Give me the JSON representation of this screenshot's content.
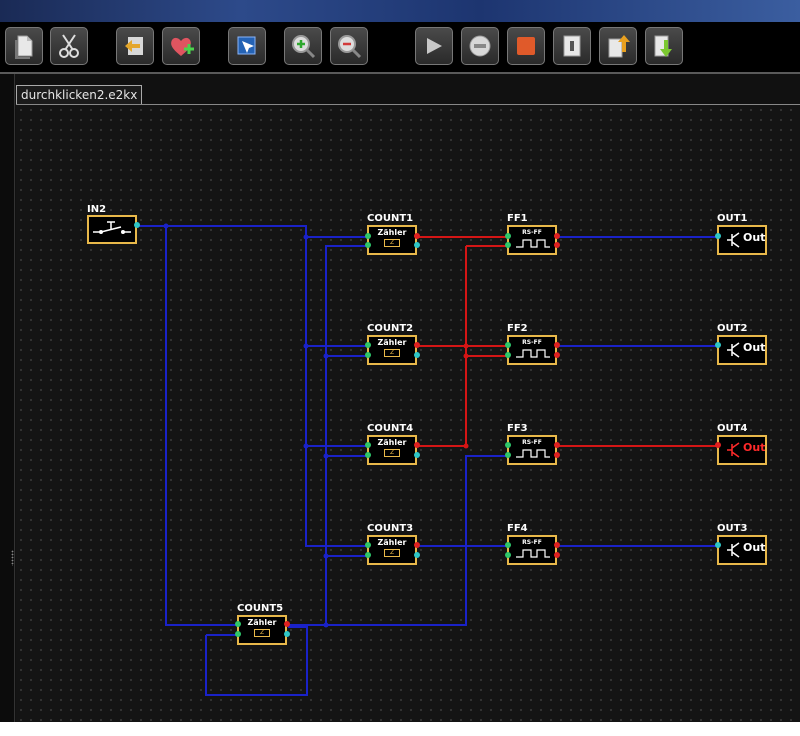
{
  "toolbar": {
    "buttons": [
      {
        "name": "new-button",
        "icon": "new-document-icon"
      },
      {
        "name": "cut-button",
        "icon": "scissors-icon"
      },
      {
        "name": "back-button",
        "icon": "arrow-left-icon"
      },
      {
        "name": "add-favorite-button",
        "icon": "heart-plus-icon"
      },
      {
        "name": "select-button",
        "icon": "select-cursor-icon"
      },
      {
        "name": "zoom-in-button",
        "icon": "zoom-in-icon"
      },
      {
        "name": "zoom-out-button",
        "icon": "zoom-out-icon"
      },
      {
        "name": "play-button",
        "icon": "play-icon"
      },
      {
        "name": "record-button",
        "icon": "record-icon"
      },
      {
        "name": "stop-button",
        "icon": "stop-icon"
      },
      {
        "name": "switch-button",
        "icon": "switch-icon"
      },
      {
        "name": "upload-button",
        "icon": "arrow-up-icon"
      },
      {
        "name": "download-button",
        "icon": "arrow-down-icon"
      }
    ]
  },
  "tab": {
    "title": "durchklicken2.e2kx"
  },
  "diagram": {
    "input": {
      "label": "IN2"
    },
    "counters": [
      {
        "label": "COUNT1",
        "text": "Zähler",
        "sub": "Z"
      },
      {
        "label": "COUNT2",
        "text": "Zähler",
        "sub": "Z"
      },
      {
        "label": "COUNT4",
        "text": "Zähler",
        "sub": "Z"
      },
      {
        "label": "COUNT3",
        "text": "Zähler",
        "sub": "Z"
      },
      {
        "label": "COUNT5",
        "text": "Zähler",
        "sub": "Z"
      }
    ],
    "flipflops": [
      {
        "label": "FF1",
        "text": "RS-FF"
      },
      {
        "label": "FF2",
        "text": "RS-FF"
      },
      {
        "label": "FF3",
        "text": "RS-FF"
      },
      {
        "label": "FF4",
        "text": "RS-FF"
      }
    ],
    "outputs": [
      {
        "label": "OUT1",
        "text": "Out"
      },
      {
        "label": "OUT2",
        "text": "Out"
      },
      {
        "label": "OUT4",
        "text": "Out"
      },
      {
        "label": "OUT3",
        "text": "Out"
      }
    ]
  },
  "colors": {
    "wire_blue": "#1a22c8",
    "wire_red": "#d41515",
    "component_border": "#e8b84a",
    "active_output": "#ff2a2a"
  }
}
